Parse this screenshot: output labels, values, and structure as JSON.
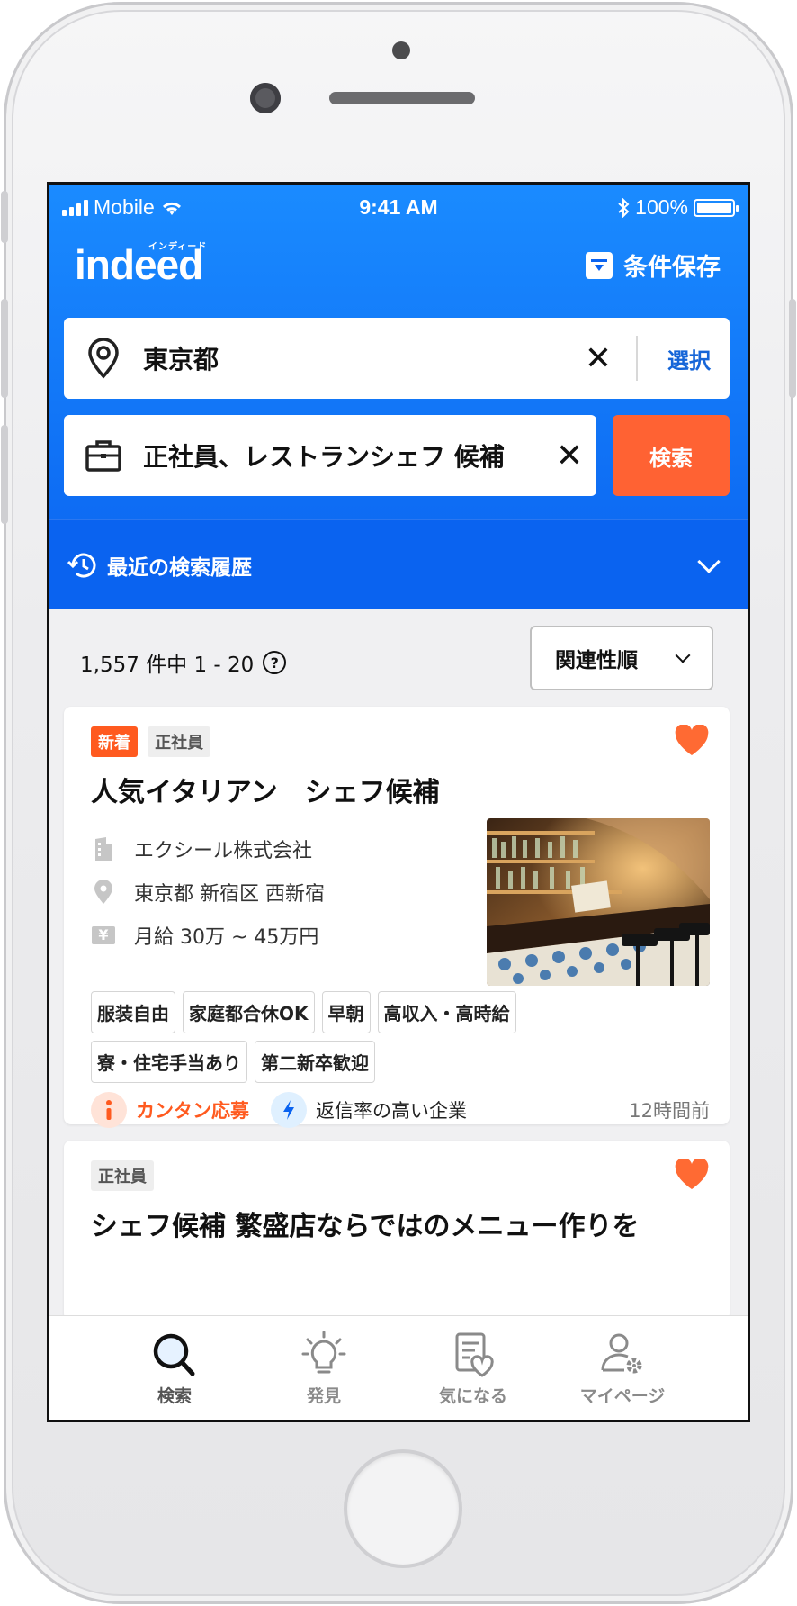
{
  "status": {
    "carrier": "Mobile",
    "time": "9:41 AM",
    "battery": "100%"
  },
  "header": {
    "logo": "indeed",
    "logo_sub": "インディード",
    "save_label": "条件保存",
    "location": {
      "value": "東京都",
      "select_label": "選択"
    },
    "keyword": {
      "value": "正社員、レストランシェフ 候補"
    },
    "search_label": "検索",
    "history_label": "最近の検索履歴"
  },
  "results": {
    "summary": "1,557 件中 1 - 20",
    "help": "?",
    "sort_label": "関連性順"
  },
  "jobs": [
    {
      "badges": {
        "new": "新着",
        "type": "正社員"
      },
      "title": "人気イタリアン　シェフ候補",
      "company": "エクシール株式会社",
      "location": "東京都 新宿区 西新宿",
      "salary": "月給 30万 ~ 45万円",
      "salary_symbol": "¥",
      "tags": [
        "服装自由",
        "家庭都合休OK",
        "早朝",
        "高収入・高時給",
        "寮・住宅手当あり",
        "第二新卒歓迎"
      ],
      "easy_apply": "カンタン応募",
      "reply_rate": "返信率の高い企業",
      "posted": "12時間前",
      "saved": true
    },
    {
      "badges": {
        "type": "正社員"
      },
      "title": "シェフ候補 繁盛店ならではのメニュー作りを",
      "saved": true
    }
  ],
  "tabs": [
    {
      "label": "検索",
      "icon": "search-icon"
    },
    {
      "label": "発見",
      "icon": "lightbulb-icon"
    },
    {
      "label": "気になる",
      "icon": "saved-list-heart-icon"
    },
    {
      "label": "マイページ",
      "icon": "user-settings-icon"
    }
  ],
  "colors": {
    "brand_blue": "#0a63f0",
    "accent_orange": "#ff6233",
    "heart": "#ff6a33"
  }
}
